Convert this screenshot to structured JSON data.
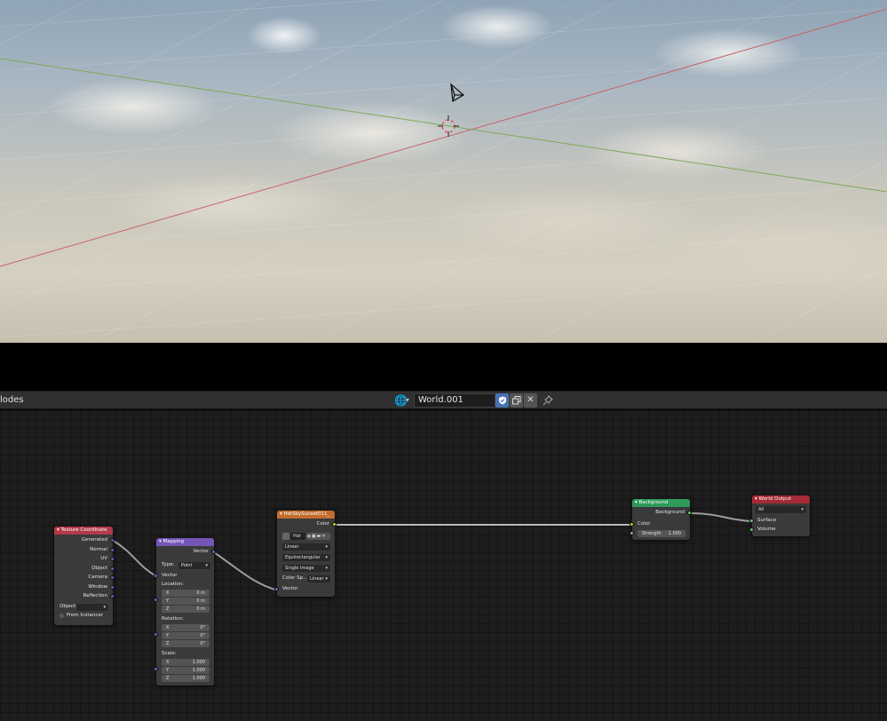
{
  "editor": {
    "title": "lodes",
    "world_name": "World.001",
    "icons": {
      "world": "world-icon",
      "fake_user": "shield-check-icon",
      "duplicate": "duplicate-icon",
      "unlink": "close-icon",
      "pin": "pin-icon"
    }
  },
  "colors": {
    "tex_coord_header": "#b33a4a",
    "mapping_header": "#7556b8",
    "env_tex_header": "#c26c2e",
    "background_header": "#2f9a5a",
    "output_header": "#a52a35",
    "vector_socket": "#6363c7",
    "color_socket": "#c7c729",
    "shader_socket": "#63c763"
  },
  "nodes": {
    "tex_coord": {
      "title": "Texture Coordinate",
      "outputs": [
        "Generated",
        "Normal",
        "UV",
        "Object",
        "Camera",
        "Window",
        "Reflection"
      ],
      "object_label": "Object:",
      "from_instancer": "From Instancer"
    },
    "mapping": {
      "title": "Mapping",
      "output": "Vector",
      "type_label": "Type:",
      "type_value": "Point",
      "input_vector": "Vector",
      "location_label": "Location:",
      "location": [
        {
          "axis": "X",
          "value": "0 m"
        },
        {
          "axis": "Y",
          "value": "0 m"
        },
        {
          "axis": "Z",
          "value": "0 m"
        }
      ],
      "rotation_label": "Rotation:",
      "rotation": [
        {
          "axis": "X",
          "value": "0°"
        },
        {
          "axis": "Y",
          "value": "0°"
        },
        {
          "axis": "Z",
          "value": "0°"
        }
      ],
      "scale_label": "Scale:",
      "scale": [
        {
          "axis": "X",
          "value": "1.000"
        },
        {
          "axis": "Y",
          "value": "1.000"
        },
        {
          "axis": "Z",
          "value": "1.000"
        }
      ]
    },
    "env_tex": {
      "title": "HdrSkySunset011_",
      "output": "Color",
      "image_name": "Hdr",
      "interpolation": "Linear",
      "projection": "Equirectangular",
      "source": "Single Image",
      "colorspace_label": "Color Sp...",
      "colorspace_value": "Linear",
      "input_vector": "Vector"
    },
    "background": {
      "title": "Background",
      "output": "Background",
      "input_color": "Color",
      "strength_label": "Strength",
      "strength_value": "1.000"
    },
    "world_output": {
      "title": "World Output",
      "target": "All",
      "surface": "Surface",
      "volume": "Volume"
    }
  }
}
